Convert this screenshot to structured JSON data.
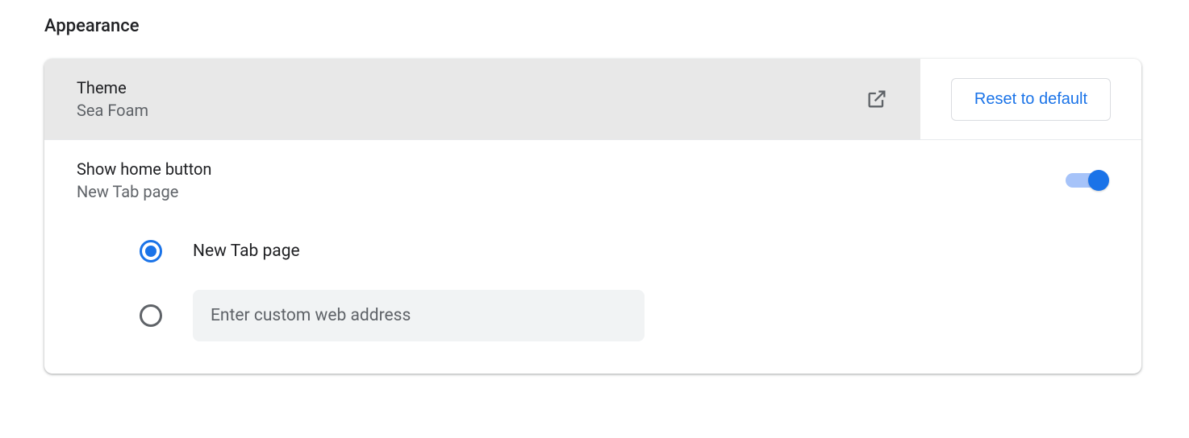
{
  "section_title": "Appearance",
  "theme": {
    "label": "Theme",
    "value": "Sea Foam",
    "reset_label": "Reset to default"
  },
  "home_button": {
    "label": "Show home button",
    "value": "New Tab page",
    "enabled": true,
    "options": {
      "new_tab_label": "New Tab page",
      "custom_placeholder": "Enter custom web address",
      "custom_value": ""
    }
  }
}
